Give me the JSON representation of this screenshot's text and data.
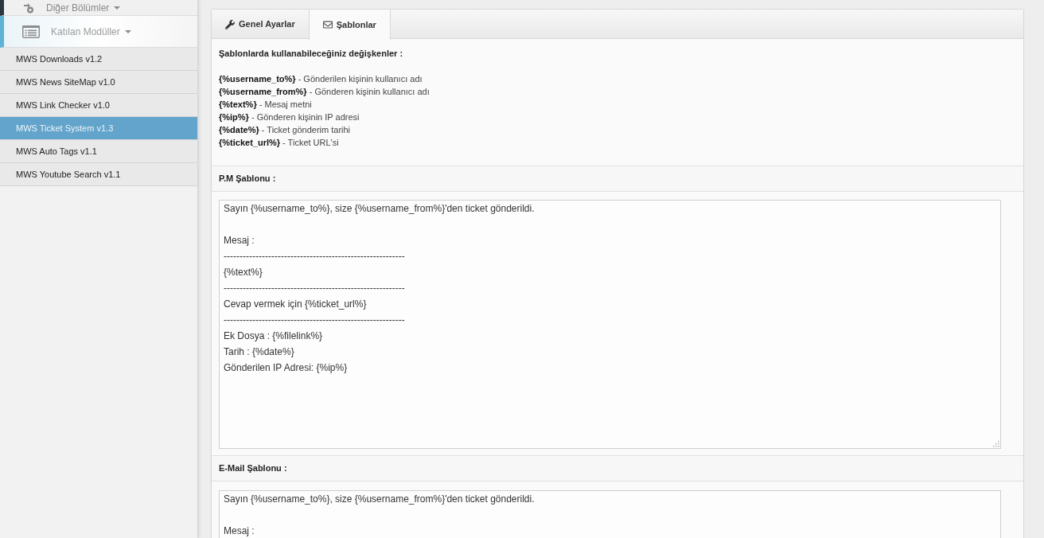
{
  "sidebar": {
    "sections": [
      {
        "label": "Diğer Bölümler",
        "selected": false
      },
      {
        "label": "Katılan Modüller",
        "selected": true,
        "children": [
          {
            "label": "MWS Downloads v1.2",
            "selected": false
          },
          {
            "label": "MWS News SiteMap v1.0",
            "selected": false
          },
          {
            "label": "MWS Link Checker v1.0",
            "selected": false
          },
          {
            "label": "MWS Ticket System v1.3",
            "selected": true
          },
          {
            "label": "MWS Auto Tags v1.1",
            "selected": false
          },
          {
            "label": "MWS Youtube Search v1.1",
            "selected": false
          }
        ]
      }
    ]
  },
  "tabs": [
    {
      "label": "Genel Ayarlar",
      "selected": false
    },
    {
      "label": "Şablonlar",
      "selected": true
    }
  ],
  "variables": {
    "title": "Şablonlarda kullanabileceğiniz değişkenler :",
    "items": [
      "**{%username_to%}** - Gönderilen kişinin kullanıcı adı",
      "**{%username_from%}** - Gönderen kişinin kullanıcı adı",
      "**{%text%}** - Mesaj metni",
      "**{%ip%}** - Gönderen kişinin IP adresi",
      "**{%date%}** - Ticket gönderim tarihi",
      "**{%ticket_url%}** - Ticket URL'si"
    ]
  },
  "templates": [
    {
      "label": "P.M Şablonu :",
      "value": "Sayın {%username_to%}, size {%username_from%}'den ticket gönderildi.\n\nMesaj :\n---------------------------------------------------------\n{%text%}\n---------------------------------------------------------\nCevap vermek için {%ticket_url%}\n---------------------------------------------------------\nEk Dosya : {%filelink%}\nTarih : {%date%}\nGönderilen IP Adresi: {%ip%}"
    },
    {
      "label": "E-Mail Şablonu :",
      "value": "Sayın {%username_to%}, size {%username_from%}'den ticket gönderildi.\n\nMesaj :"
    }
  ]
}
